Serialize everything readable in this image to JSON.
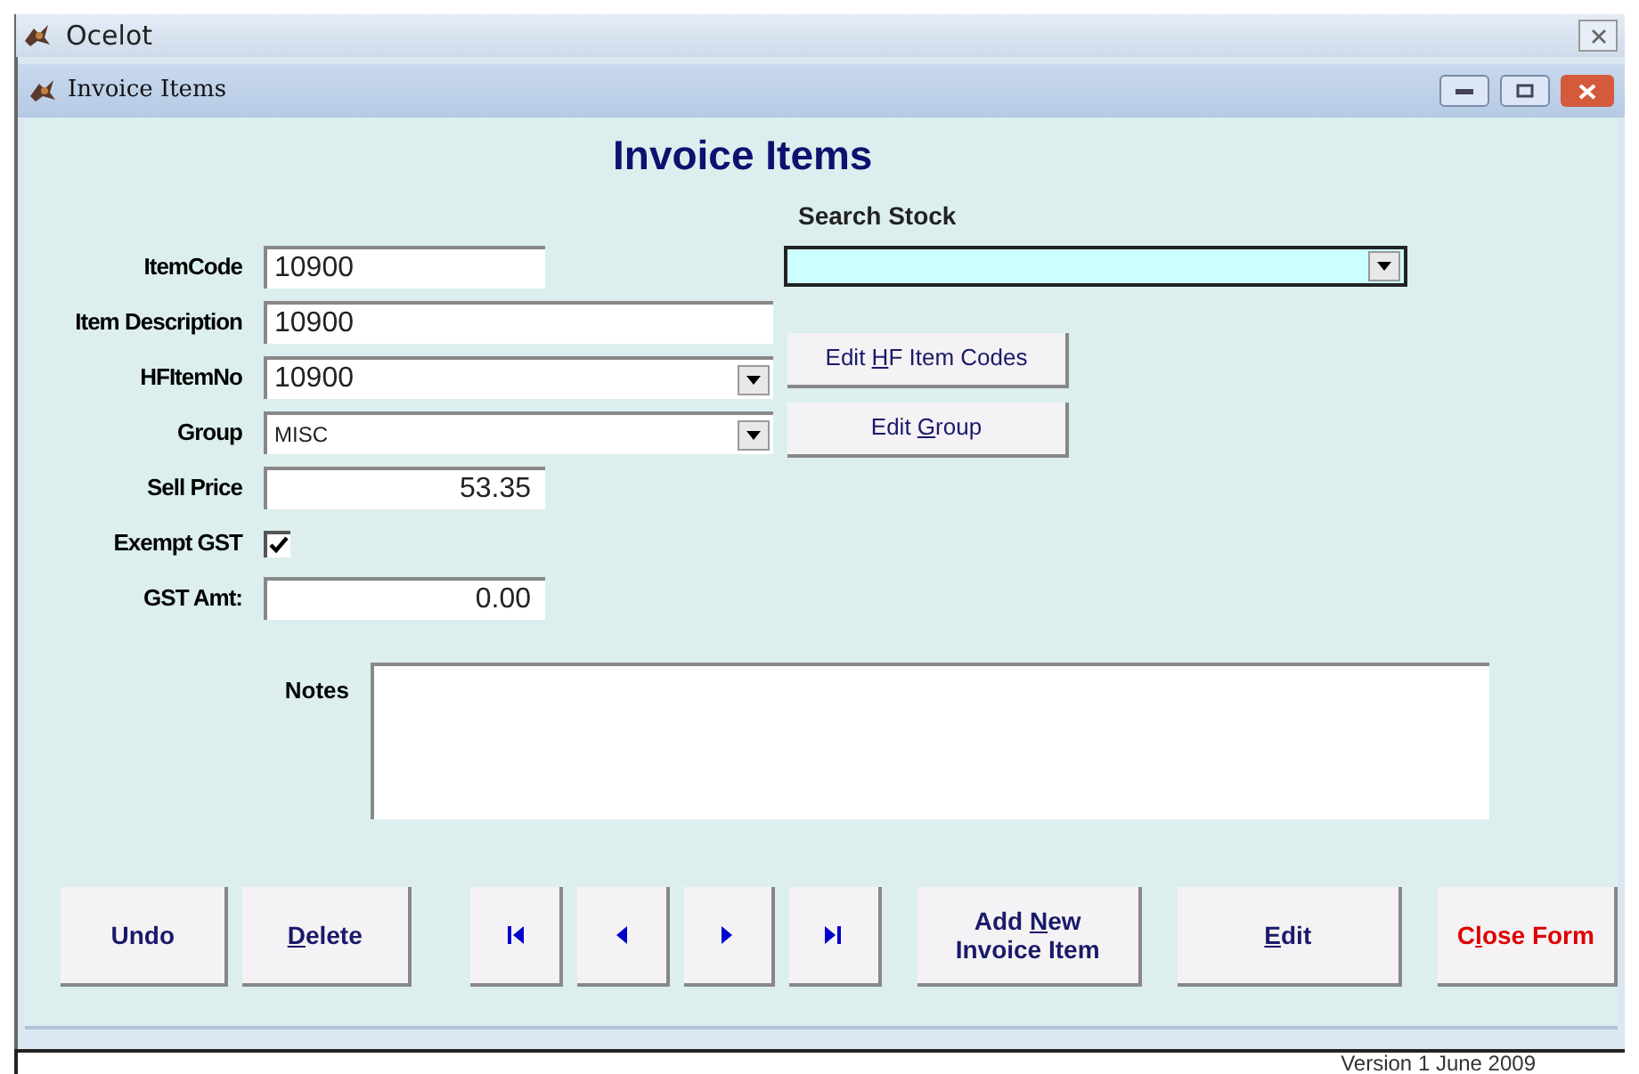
{
  "app_window": {
    "title": "Ocelot"
  },
  "form_window": {
    "title": "Invoice Items"
  },
  "heading": "Invoice Items",
  "fields": [
    {
      "kind": "text",
      "label": "ItemCode",
      "value": "10900"
    },
    {
      "kind": "text",
      "label": "Item Description",
      "value": "10900"
    },
    {
      "kind": "combo",
      "label": "HFItemNo",
      "value": "10900"
    },
    {
      "kind": "combo",
      "label": "Group",
      "value": "MISC"
    },
    {
      "kind": "number",
      "label": "Sell Price",
      "value": "53.35"
    },
    {
      "kind": "checkbox",
      "label": "Exempt GST",
      "checked": true
    },
    {
      "kind": "number",
      "label": "GST Amt:",
      "value": "0.00"
    }
  ],
  "search_stock": {
    "label": "Search Stock"
  },
  "side_buttons": [
    {
      "label_parts": [
        {
          "text": "Edit ",
          "access_key": false
        },
        {
          "text": "H",
          "access_key": true
        },
        {
          "text": "F Item Codes",
          "access_key": false
        }
      ]
    },
    {
      "label_parts": [
        {
          "text": "Edit ",
          "access_key": false
        },
        {
          "text": "G",
          "access_key": true
        },
        {
          "text": "roup",
          "access_key": false
        }
      ]
    }
  ],
  "notes": {
    "label": "Notes"
  },
  "buttons": [
    {
      "kind": "text",
      "label_parts": [
        {
          "text": "Undo",
          "access_key": false
        }
      ]
    },
    {
      "kind": "text",
      "label_parts": [
        {
          "text": "D",
          "access_key": true
        },
        {
          "text": "elete",
          "access_key": false
        }
      ]
    },
    {
      "kind": "first"
    },
    {
      "kind": "prev"
    },
    {
      "kind": "next"
    },
    {
      "kind": "last"
    },
    {
      "kind": "text",
      "label_parts": [
        {
          "text": "Add ",
          "access_key": false
        },
        {
          "text": "N",
          "access_key": true
        },
        {
          "text": "ew Invoice Item",
          "access_key": false
        }
      ]
    },
    {
      "kind": "text",
      "label_parts": [
        {
          "text": "E",
          "access_key": true
        },
        {
          "text": "dit",
          "access_key": false
        }
      ]
    },
    {
      "kind": "danger",
      "label_parts": [
        {
          "text": "C",
          "access_key": false
        },
        {
          "text": "l",
          "access_key": true
        },
        {
          "text": "ose Form",
          "access_key": false
        }
      ]
    }
  ],
  "status_bar": {
    "version": "Version 1 June 2009"
  }
}
